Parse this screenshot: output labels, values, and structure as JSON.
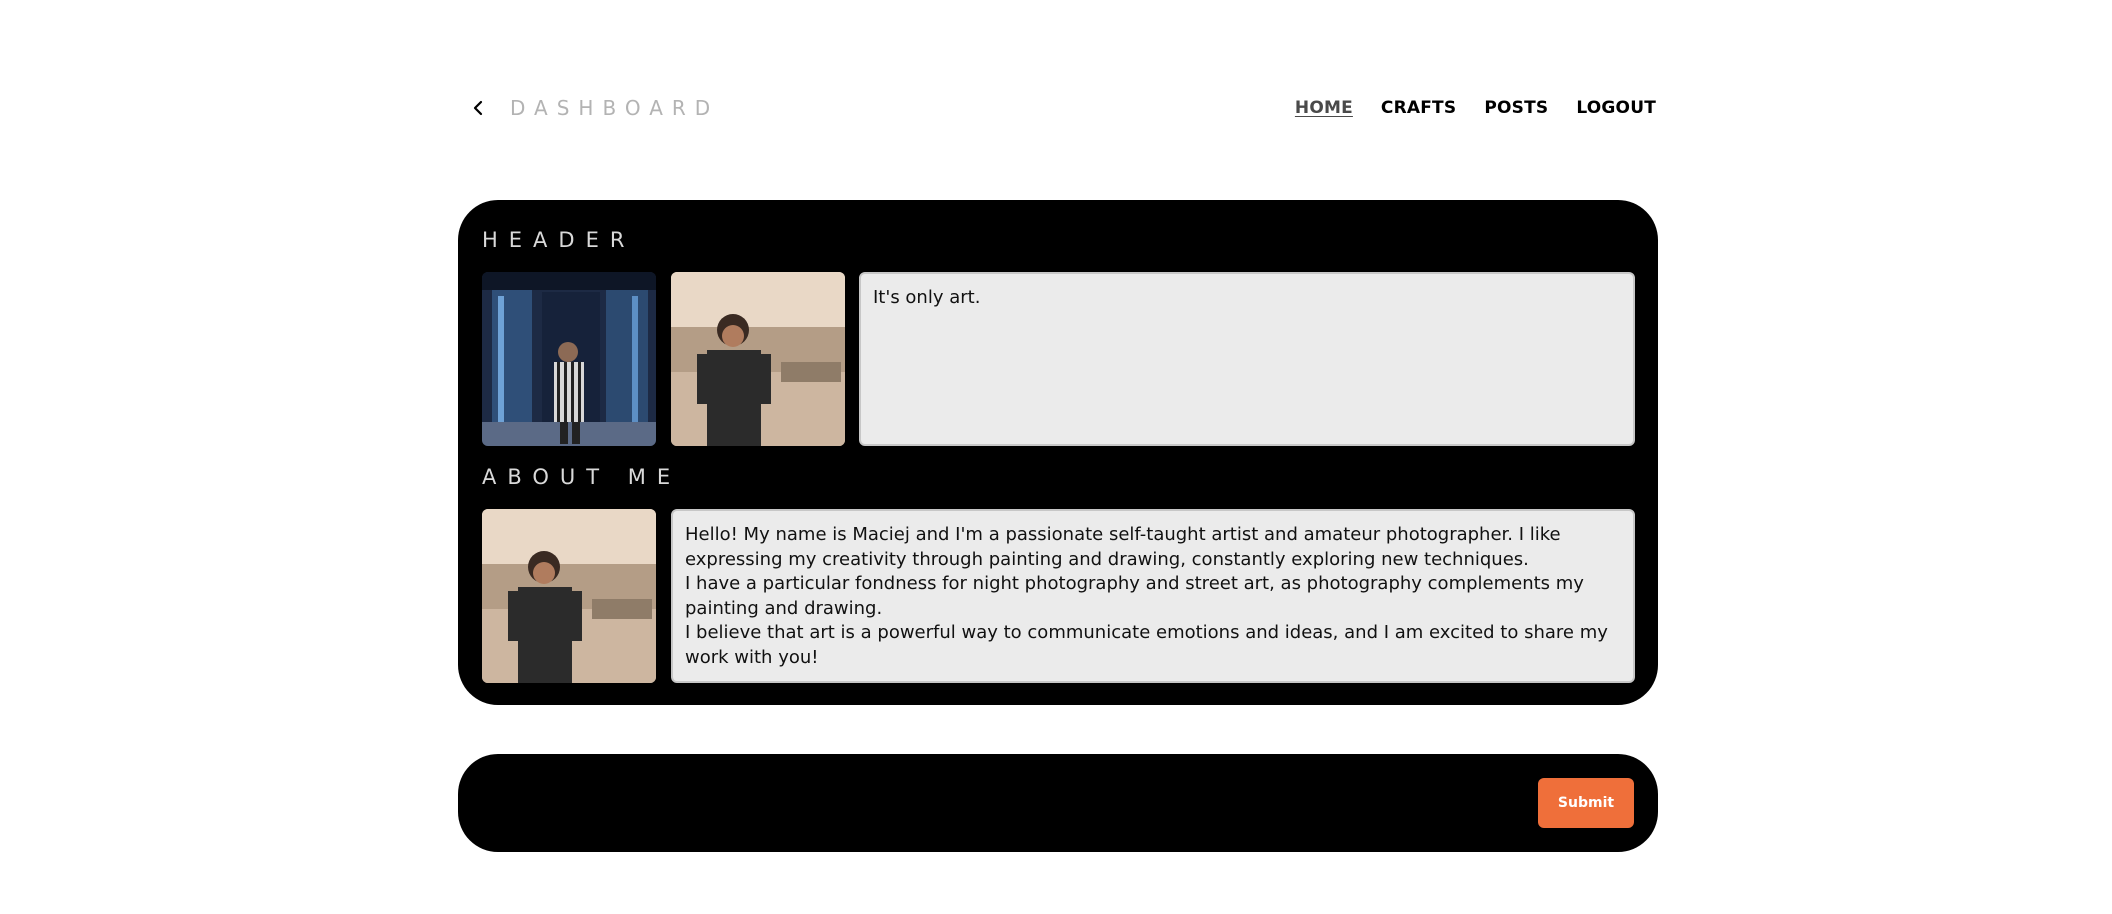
{
  "header": {
    "brand": "DASHBOARD",
    "back_icon": "chevron-left-icon",
    "nav": [
      {
        "label": "HOME",
        "active": true
      },
      {
        "label": "CRAFTS",
        "active": false
      },
      {
        "label": "POSTS",
        "active": false
      },
      {
        "label": "LOGOUT",
        "active": false
      }
    ]
  },
  "sections": {
    "header": {
      "title": "HEADER",
      "images": [
        "photo of man in striped shirt with camera",
        "photo of man in black t-shirt on terrace"
      ],
      "text": "It's only art."
    },
    "about": {
      "title": "ABOUT ME",
      "images": [
        "photo of man in black t-shirt on terrace"
      ],
      "text": "Hello! My name is Maciej and I'm a passionate self-taught artist and amateur photographer. I like expressing my creativity through painting and drawing, constantly exploring new techniques.\nI have a particular fondness for night photography and street art, as photography complements my painting and drawing.\nI believe that art is a powerful way to communicate emotions and ideas, and I am excited to share my work with you!"
    }
  },
  "actions": {
    "submit_label": "Submit"
  },
  "colors": {
    "accent": "#ef6f3a",
    "card_bg": "#000000",
    "textbox_bg": "#ebebeb"
  }
}
